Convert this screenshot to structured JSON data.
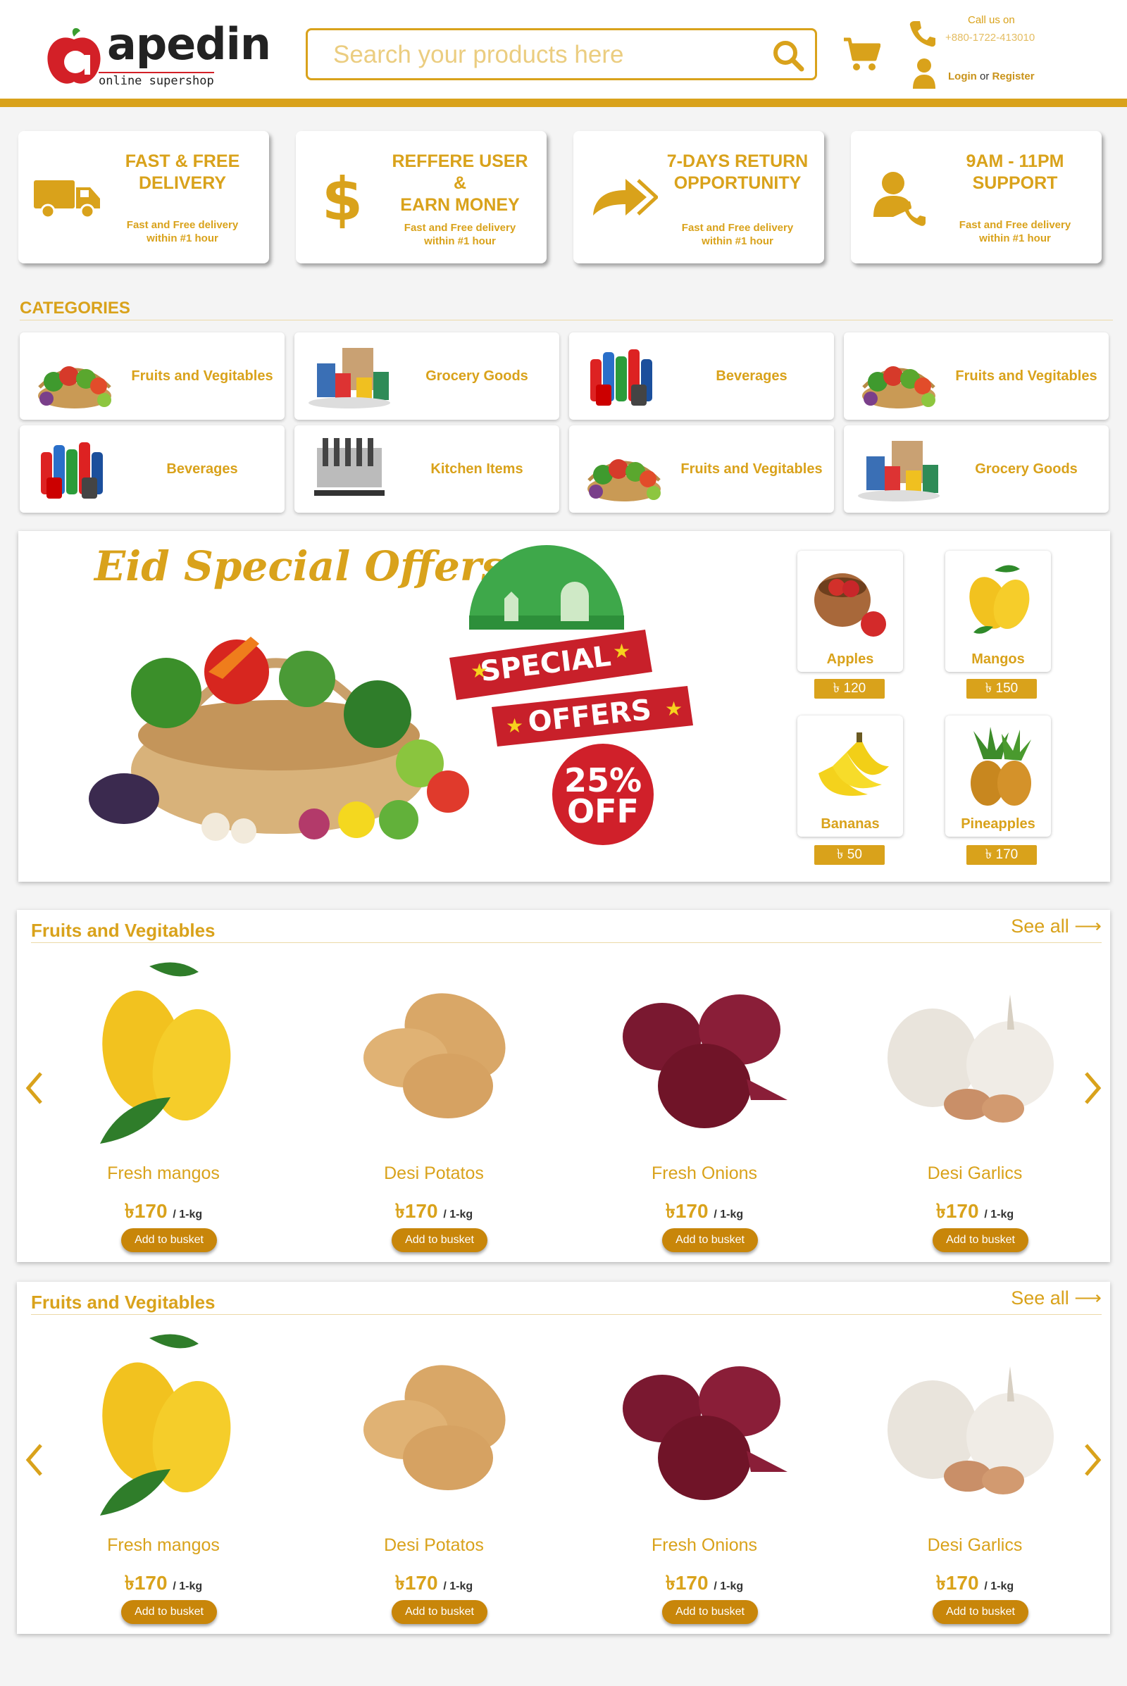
{
  "brand": {
    "name": "apedin",
    "tagline": "online supershop"
  },
  "search": {
    "placeholder": "Search your products here"
  },
  "contact": {
    "label": "Call us on",
    "phone": "+880-1722-413010"
  },
  "auth": {
    "login": "Login",
    "or": "or",
    "register": "Register"
  },
  "features": [
    {
      "title_lines": [
        "FAST & FREE",
        "DELIVERY"
      ],
      "sub_lines": [
        "Fast and Free delivery",
        "within #1 hour"
      ],
      "icon": "truck-icon"
    },
    {
      "title_lines": [
        "REFFERE USER",
        "&",
        "EARN MONEY"
      ],
      "sub_lines": [
        "Fast and Free delivery",
        "within #1 hour"
      ],
      "icon": "dollar-icon"
    },
    {
      "title_lines": [
        "7-DAYS RETURN",
        "OPPORTUNITY"
      ],
      "sub_lines": [
        "Fast and Free delivery",
        "within #1 hour"
      ],
      "icon": "return-arrow-icon"
    },
    {
      "title_lines": [
        "9AM - 11PM",
        "SUPPORT"
      ],
      "sub_lines": [
        "Fast and Free delivery",
        "within #1 hour"
      ],
      "icon": "support-icon"
    }
  ],
  "categories": {
    "title": "CATEGORIES",
    "items": [
      {
        "label": "Fruits and Vegitables",
        "icon": "veg-basket"
      },
      {
        "label": "Grocery Goods",
        "icon": "grocery"
      },
      {
        "label": "Beverages",
        "icon": "beverages"
      },
      {
        "label": "Fruits and Vegitables",
        "icon": "veg-basket"
      },
      {
        "label": "Beverages",
        "icon": "beverages"
      },
      {
        "label": "Kitchen Items",
        "icon": "kitchen"
      },
      {
        "label": "Fruits and Vegitables",
        "icon": "veg-basket"
      },
      {
        "label": "Grocery Goods",
        "icon": "grocery"
      }
    ]
  },
  "offer": {
    "title": "Eid Special Offers",
    "badge_line1": "SPECIAL",
    "badge_line2": "OFFERS",
    "discount_pct": "25%",
    "discount_off": "OFF",
    "items": [
      {
        "name": "Apples",
        "price": "120",
        "icon": "apple"
      },
      {
        "name": "Mangos",
        "price": "150",
        "icon": "mango"
      },
      {
        "name": "Bananas",
        "price": "50",
        "icon": "banana"
      },
      {
        "name": "Pineapples",
        "price": "170",
        "icon": "pineapple"
      }
    ]
  },
  "currency": "৳",
  "sections": [
    {
      "title": "Fruits and Vegitables",
      "see_all": "See all",
      "products": [
        {
          "name": "Fresh mangos",
          "price": "170",
          "unit": "/ 1-kg",
          "button": "Add to busket",
          "icon": "mango"
        },
        {
          "name": "Desi Potatos",
          "price": "170",
          "unit": "/ 1-kg",
          "button": "Add to busket",
          "icon": "potato"
        },
        {
          "name": "Fresh Onions",
          "price": "170",
          "unit": "/ 1-kg",
          "button": "Add to busket",
          "icon": "onion"
        },
        {
          "name": "Desi Garlics",
          "price": "170",
          "unit": "/ 1-kg",
          "button": "Add to busket",
          "icon": "garlic"
        }
      ]
    },
    {
      "title": "Fruits and Vegitables",
      "see_all": "See all",
      "products": [
        {
          "name": "Fresh mangos",
          "price": "170",
          "unit": "/ 1-kg",
          "button": "Add to busket",
          "icon": "mango"
        },
        {
          "name": "Desi Potatos",
          "price": "170",
          "unit": "/ 1-kg",
          "button": "Add to busket",
          "icon": "potato"
        },
        {
          "name": "Fresh Onions",
          "price": "170",
          "unit": "/ 1-kg",
          "button": "Add to busket",
          "icon": "onion"
        },
        {
          "name": "Desi Garlics",
          "price": "170",
          "unit": "/ 1-kg",
          "button": "Add to busket",
          "icon": "garlic"
        }
      ]
    }
  ],
  "colors": {
    "accent": "#d9a21b",
    "brand_red": "#d32027",
    "button": "#c8860a"
  }
}
